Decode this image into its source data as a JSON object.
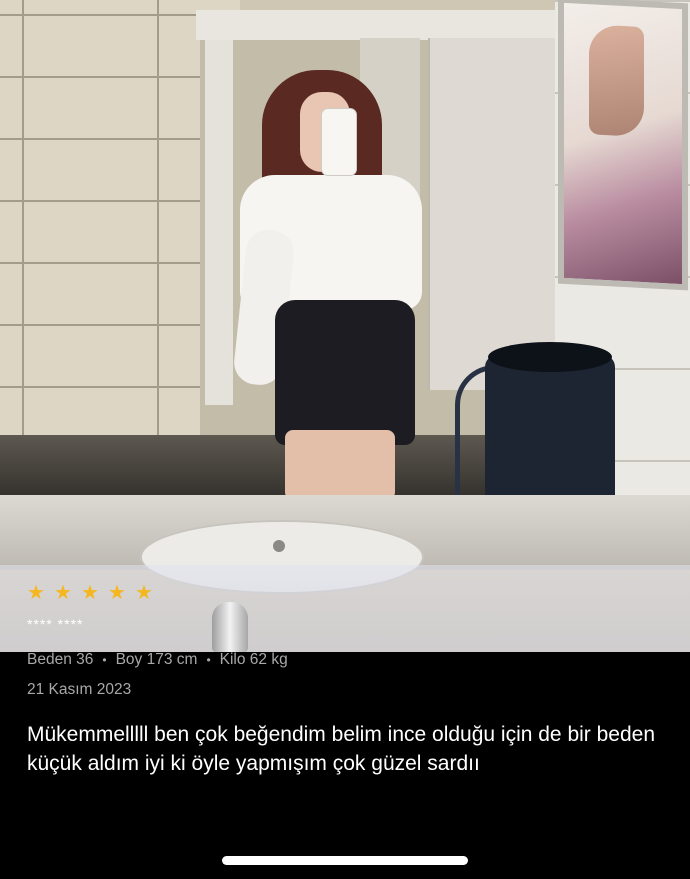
{
  "review": {
    "rating": 5,
    "max_rating": 5,
    "star_color": "#f5b721",
    "reviewer_name": "**** ****",
    "size_label": "Beden 36",
    "height_label": "Boy 173 cm",
    "weight_label": "Kilo 62 kg",
    "separator": "•",
    "date": "21 Kasım 2023",
    "text": "Mükemmelllll ben çok beğendim belim ince olduğu için de bir beden küçük aldım iyi ki öyle yapmışım çok güzel sardıı"
  },
  "icons": {
    "star": "star-icon"
  }
}
